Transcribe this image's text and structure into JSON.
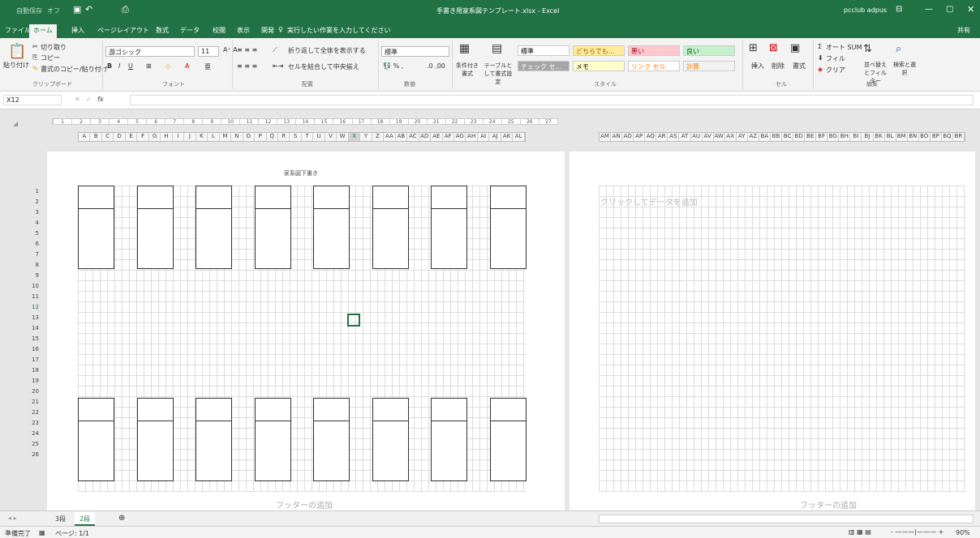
{
  "app": {
    "autosave": "自動保存",
    "autosave_state": "オフ",
    "filename": "手書き用家系図テンプレート.xlsx - Excel",
    "user": "pcclub adpus"
  },
  "tabs": [
    "ファイル",
    "ホーム",
    "挿入",
    "ページレイアウト",
    "数式",
    "データ",
    "校閲",
    "表示",
    "開発"
  ],
  "tellme": "実行したい作業を入力してください",
  "share": "共有",
  "ribbon": {
    "paste": "貼り付け",
    "cut": "切り取り",
    "copy": "コピー",
    "painter": "書式のコピー/貼り付け",
    "clipboard": "クリップボード",
    "font_name": "游ゴシック",
    "font_size": "11",
    "font": "フォント",
    "wrap": "折り返して全体を表示する",
    "merge": "セルを結合して中央揃え",
    "align": "配置",
    "numfmt": "標準",
    "number": "数値",
    "cond": "条件付き書式",
    "table": "テーブルとして書式設定",
    "styles": "スタイル",
    "insert": "挿入",
    "delete": "削除",
    "format": "書式",
    "cells": "セル",
    "autosum": "オート SUM",
    "fill": "フィル",
    "clear": "クリア",
    "sort": "並べ替えとフィルター",
    "find": "検索と選択",
    "edit": "編集"
  },
  "style_cells": [
    {
      "t": "標準",
      "bg": "#ffffff",
      "c": "#000000"
    },
    {
      "t": "どちらでも...",
      "bg": "#ffeb9c",
      "c": "#9c6500"
    },
    {
      "t": "悪い",
      "bg": "#ffc7ce",
      "c": "#9c0006"
    },
    {
      "t": "良い",
      "bg": "#c6efce",
      "c": "#006100"
    },
    {
      "t": "チェック セ...",
      "bg": "#a5a5a5",
      "c": "#ffffff"
    },
    {
      "t": "メモ",
      "bg": "#ffffcc",
      "c": "#000000"
    },
    {
      "t": "リンク セル",
      "bg": "#ffffff",
      "c": "#fa7d00"
    },
    {
      "t": "計算",
      "bg": "#f2f2f2",
      "c": "#fa7d00"
    }
  ],
  "namebox": "X12",
  "fx": "fx",
  "columns": [
    "A",
    "B",
    "C",
    "D",
    "E",
    "F",
    "G",
    "H",
    "I",
    "J",
    "K",
    "L",
    "M",
    "N",
    "O",
    "P",
    "Q",
    "R",
    "S",
    "T",
    "U",
    "V",
    "W",
    "X",
    "Y",
    "Z",
    "AA",
    "AB",
    "AC",
    "AD",
    "AE",
    "AF",
    "AG",
    "AH",
    "AI",
    "AJ",
    "AK",
    "AL"
  ],
  "columns2": [
    "AM",
    "AN",
    "AO",
    "AP",
    "AQ",
    "AR",
    "AS",
    "AT",
    "AU",
    "AV",
    "AW",
    "AX",
    "AY",
    "AZ",
    "BA",
    "BB",
    "BC",
    "BD",
    "BE",
    "BF",
    "BG",
    "BH",
    "BI",
    "BJ",
    "BK",
    "BL",
    "BM",
    "BN",
    "BO",
    "BP",
    "BQ",
    "BR"
  ],
  "ruler": [
    "1",
    "2",
    "3",
    "4",
    "5",
    "6",
    "7",
    "8",
    "9",
    "10",
    "11",
    "12",
    "13",
    "14",
    "15",
    "16",
    "17",
    "18",
    "19",
    "20",
    "21",
    "22",
    "23",
    "24",
    "25",
    "26",
    "27"
  ],
  "rows": [
    "1",
    "2",
    "3",
    "4",
    "5",
    "6",
    "7",
    "8",
    "9",
    "10",
    "11",
    "12",
    "13",
    "14",
    "15",
    "16",
    "17",
    "18",
    "19",
    "20",
    "21",
    "22",
    "23",
    "24",
    "25",
    "26"
  ],
  "page_header": "家系図下書き",
  "add_data": "クリックしてデータを追加",
  "footer": "フッターの追加",
  "sheets": [
    "3段",
    "2段"
  ],
  "status": "準備完了",
  "page": "ページ: 1/1",
  "zoom": "90%",
  "accent": "#217346"
}
